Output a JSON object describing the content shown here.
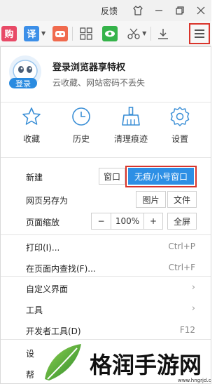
{
  "titlebar": {
    "feedback": "反馈",
    "shirt_icon": "shirt-icon",
    "minimize": "minimize-icon",
    "restore": "restore-icon",
    "close": "close-icon"
  },
  "toolbar": {
    "icons": [
      "purchase-app-icon",
      "translate-app-icon",
      "game-app-icon",
      "apps-grid-icon",
      "eye-protect-icon",
      "screenshot-scissors-icon",
      "download-icon",
      "menu-icon"
    ],
    "purchase_label": "购",
    "translate_label": "译"
  },
  "login": {
    "button": "登录",
    "title": "登录浏览器享特权",
    "subtitle": "云收藏、网站密码不丢失"
  },
  "quick": [
    {
      "label": "收藏",
      "icon": "star-icon"
    },
    {
      "label": "历史",
      "icon": "clock-icon"
    },
    {
      "label": "清理痕迹",
      "icon": "broom-icon"
    },
    {
      "label": "设置",
      "icon": "gear-icon"
    }
  ],
  "menu": {
    "new": {
      "label": "新建",
      "window": "窗口",
      "incognito": "无痕/小号窗口"
    },
    "save_as": {
      "label": "网页另存为",
      "image": "图片",
      "file": "文件"
    },
    "zoom": {
      "label": "页面缩放",
      "minus": "−",
      "value": "100%",
      "plus": "+",
      "fullscreen": "全屏"
    },
    "print": {
      "label": "打印(I)...",
      "shortcut": "Ctrl+P"
    },
    "find": {
      "label": "在页面内查找(F)...",
      "shortcut": "Ctrl+F"
    },
    "customize": {
      "label": "自定义界面"
    },
    "tools": {
      "label": "工具"
    },
    "devtools": {
      "label": "开发者工具(D)",
      "shortcut": "F12"
    },
    "settings": {
      "label": "设"
    },
    "help": {
      "label": "帮"
    }
  },
  "watermark": {
    "text": "格润手游网",
    "url": "www.hngrjd.com"
  },
  "colors": {
    "accent": "#2d8fe5",
    "highlight_border": "#d9342b",
    "quick_icon": "#3b8fd6"
  }
}
